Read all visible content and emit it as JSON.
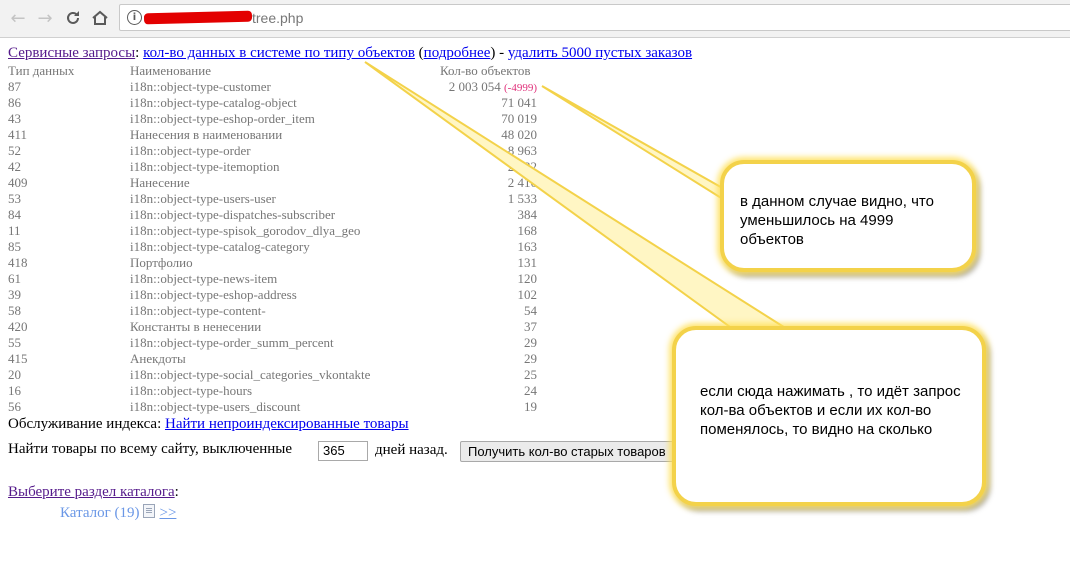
{
  "browser": {
    "url_suffix": "tree.php",
    "back_icon": "arrow-left-icon",
    "forward_icon": "arrow-right-icon",
    "reload_icon": "reload-icon",
    "home_icon": "home-icon",
    "info_icon": "info-icon"
  },
  "service": {
    "label": "Сервисные запросы",
    "colon": ":",
    "count_link": "кол-во данных в системе по типу объектов",
    "open_paren": "(",
    "details_link": "подробнее",
    "close_paren_dash": ") -",
    "delete_link": "удалить 5000 пустых заказов"
  },
  "table": {
    "headers": {
      "type": "Тип данных",
      "name": "Наименование",
      "count": "Кол-во объектов"
    },
    "rows": [
      {
        "type": "87",
        "name": "i18n::object-type-customer",
        "count": "2 003 054",
        "delta": "(-4999)"
      },
      {
        "type": "86",
        "name": "i18n::object-type-catalog-object",
        "count": "71 041"
      },
      {
        "type": "43",
        "name": "i18n::object-type-eshop-order_item",
        "count": "70 019"
      },
      {
        "type": "411",
        "name": "Нанесения в наименовании",
        "count": "48 020"
      },
      {
        "type": "52",
        "name": "i18n::object-type-order",
        "count": "8 963"
      },
      {
        "type": "42",
        "name": "i18n::object-type-itemoption",
        "count": "2 932"
      },
      {
        "type": "409",
        "name": "Нанесение",
        "count": "2 416"
      },
      {
        "type": "53",
        "name": "i18n::object-type-users-user",
        "count": "1 533"
      },
      {
        "type": "84",
        "name": "i18n::object-type-dispatches-subscriber",
        "count": "384"
      },
      {
        "type": "11",
        "name": "i18n::object-type-spisok_gorodov_dlya_geo",
        "count": "168"
      },
      {
        "type": "85",
        "name": "i18n::object-type-catalog-category",
        "count": "163"
      },
      {
        "type": "418",
        "name": "Портфолио",
        "count": "131"
      },
      {
        "type": "61",
        "name": "i18n::object-type-news-item",
        "count": "120"
      },
      {
        "type": "39",
        "name": "i18n::object-type-eshop-address",
        "count": "102"
      },
      {
        "type": "58",
        "name": "i18n::object-type-content-",
        "count": "54"
      },
      {
        "type": "420",
        "name": "Константы в ненесении",
        "count": "37"
      },
      {
        "type": "55",
        "name": "i18n::object-type-order_summ_percent",
        "count": "29"
      },
      {
        "type": "415",
        "name": "Анекдоты",
        "count": "29"
      },
      {
        "type": "20",
        "name": "i18n::object-type-social_categories_vkontakte",
        "count": "25"
      },
      {
        "type": "16",
        "name": "i18n::object-type-hours",
        "count": "24"
      },
      {
        "type": "56",
        "name": "i18n::object-type-users_discount",
        "count": "19"
      }
    ]
  },
  "maintenance": {
    "label": "Обслуживание индекса:",
    "link": "Найти непроиндексированные товары"
  },
  "old_goods": {
    "label": "Найти товары по всему сайту, выключенные",
    "days_value": "365",
    "days_label": "дней назад.",
    "button": "Получить кол-во старых товаров"
  },
  "catalog": {
    "select_link": "Выберите раздел каталога",
    "colon": ":",
    "item_label": "Каталог (19)",
    "doc_icon": "document-icon",
    "more_link": ">>"
  },
  "annotations": {
    "bubble1": "в данном случае видно, что уменьшилось на 4999 объектов",
    "bubble2": "если сюда нажимать , то идёт запрос кол-ва объектов и если их кол-во поменялось, то видно на сколько",
    "highlight_color": "#f3d24a"
  }
}
